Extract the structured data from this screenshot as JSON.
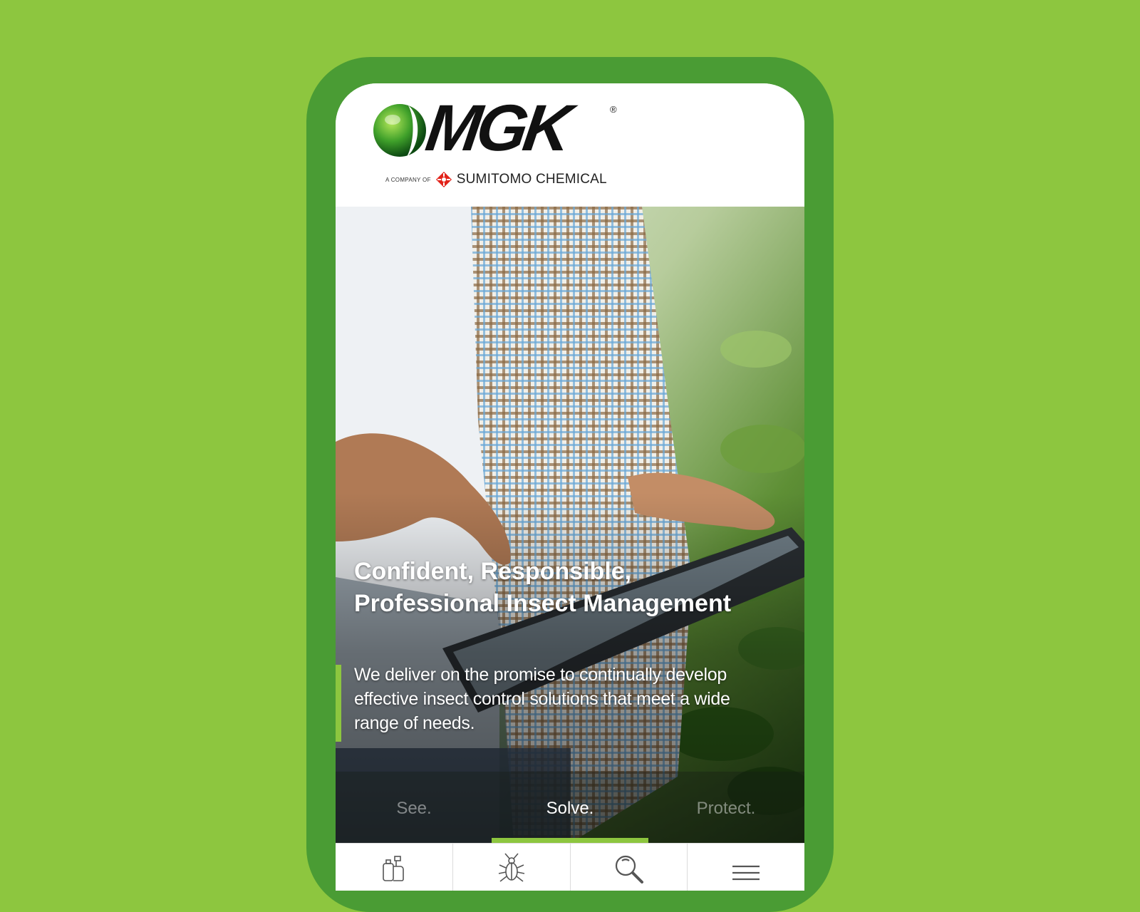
{
  "brand": {
    "logo_text": "MGK",
    "registered_mark": "®",
    "company_prefix": "A COMPANY OF",
    "parent_company": "SUMITOMO CHEMICAL"
  },
  "hero": {
    "headline_line1": "Confident, Responsible,",
    "headline_line2": "Professional Insect Management",
    "subtext": "We deliver on the promise to continually develop effective insect control solutions that meet a wide range of needs."
  },
  "tabs": [
    {
      "label": "See.",
      "active": false
    },
    {
      "label": "Solve.",
      "active": true
    },
    {
      "label": "Protect.",
      "active": false
    }
  ],
  "bottom_nav": [
    {
      "icon": "products-bottles-icon"
    },
    {
      "icon": "insect-icon"
    },
    {
      "icon": "search-icon"
    },
    {
      "icon": "hamburger-menu-icon"
    }
  ],
  "colors": {
    "background": "#8dc63f",
    "phone_frame": "#4a9c34",
    "accent": "#8dc63f",
    "sumitomo_red": "#e2231a"
  }
}
